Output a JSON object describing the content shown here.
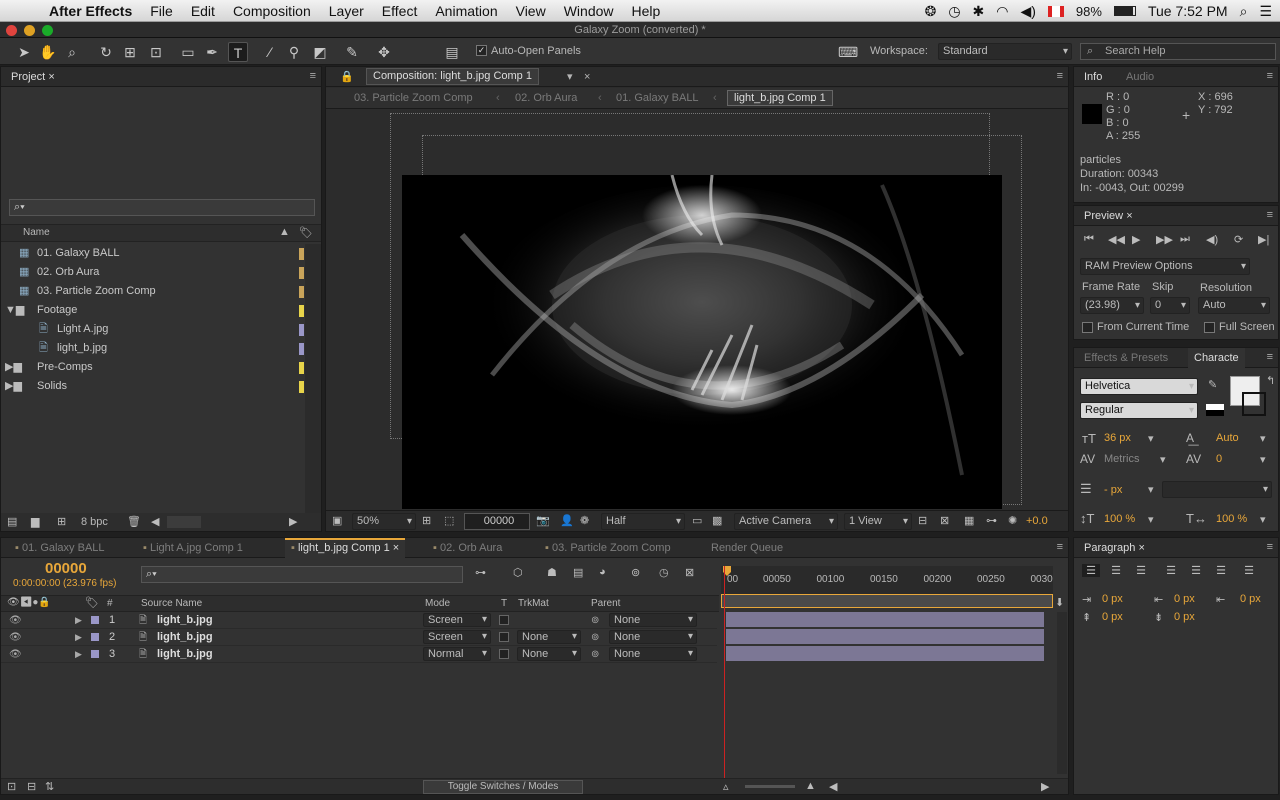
{
  "menubar": {
    "app_name": "After Effects",
    "items": [
      "File",
      "Edit",
      "Composition",
      "Layer",
      "Effect",
      "Animation",
      "View",
      "Window",
      "Help"
    ],
    "battery": "98%",
    "clock": "Tue 7:52 PM"
  },
  "window": {
    "title": "Galaxy Zoom (converted) *"
  },
  "toolbar": {
    "auto_open_panels": "Auto-Open Panels",
    "workspace_label": "Workspace:",
    "workspace_value": "Standard",
    "search_placeholder": "Search Help"
  },
  "project": {
    "tab": "Project",
    "column_name": "Name",
    "items": [
      {
        "label": "01. Galaxy BALL",
        "type": "comp",
        "color": "#c9a45a"
      },
      {
        "label": "02. Orb Aura",
        "type": "comp",
        "color": "#c9a45a"
      },
      {
        "label": "03. Particle Zoom Comp",
        "type": "comp",
        "color": "#c9a45a"
      },
      {
        "label": "Footage",
        "type": "folder-open",
        "color": "#e8d44a"
      },
      {
        "label": "Light A.jpg",
        "type": "file",
        "color": "#9a97c8"
      },
      {
        "label": "light_b.jpg",
        "type": "file",
        "color": "#9a97c8"
      },
      {
        "label": "Pre-Comps",
        "type": "folder",
        "color": "#e8d44a"
      },
      {
        "label": "Solids",
        "type": "folder",
        "color": "#e8d44a"
      }
    ],
    "bpc": "8 bpc"
  },
  "composition": {
    "tab": "Composition: light_b.jpg Comp 1",
    "breadcrumbs": [
      "03. Particle Zoom Comp",
      "02. Orb Aura",
      "01. Galaxy BALL",
      "light_b.jpg Comp 1"
    ],
    "zoom": "50%",
    "timecode": "00000",
    "resolution": "Half",
    "camera": "Active Camera",
    "view": "1 View",
    "exposure": "+0.0"
  },
  "info": {
    "tab": "Info",
    "tab2": "Audio",
    "r": "R : 0",
    "g": "G : 0",
    "b": "B : 0",
    "a": "A : 255",
    "x": "X : 696",
    "y": "Y : 792",
    "layer_name": "particles",
    "duration": "Duration: 00343",
    "in_out": "In: -0043, Out: 00299"
  },
  "preview": {
    "tab": "Preview",
    "ram_options": "RAM Preview Options",
    "frame_rate_label": "Frame Rate",
    "skip_label": "Skip",
    "resolution_label": "Resolution",
    "frame_rate": "(23.98)",
    "skip": "0",
    "resolution": "Auto",
    "from_current": "From Current Time",
    "full_screen": "Full Screen"
  },
  "character": {
    "tab_effects": "Effects & Presets",
    "tab": "Characte",
    "font": "Helvetica",
    "style": "Regular",
    "size": "36 px",
    "leading": "Auto",
    "kerning": "Metrics",
    "tracking": "0",
    "stroke": "- px",
    "vscale": "100 %",
    "hscale": "100 %"
  },
  "paragraph": {
    "tab": "Paragraph",
    "indent_left": "0 px",
    "indent_first": "0 px",
    "indent_right": "0 px",
    "space_before": "0 px",
    "space_after": "0 px"
  },
  "timeline": {
    "tabs": [
      "01. Galaxy BALL",
      "Light A.jpg Comp 1",
      "light_b.jpg Comp 1",
      "02. Orb Aura",
      "03. Particle Zoom Comp",
      "Render Queue"
    ],
    "active_tab": 2,
    "timecode": "00000",
    "timecode_sub": "0:00:00:00 (23.976 fps)",
    "columns": {
      "num": "#",
      "source": "Source Name",
      "mode": "Mode",
      "t": "T",
      "trkmat": "TrkMat",
      "parent": "Parent"
    },
    "ruler": [
      "00050",
      "00100",
      "00150",
      "00200",
      "00250",
      "0030"
    ],
    "ruler_start": "00",
    "layers": [
      {
        "num": "1",
        "name": "light_b.jpg",
        "mode": "Screen",
        "trkmat": "",
        "parent": "None"
      },
      {
        "num": "2",
        "name": "light_b.jpg",
        "mode": "Screen",
        "trkmat": "None",
        "parent": "None"
      },
      {
        "num": "3",
        "name": "light_b.jpg",
        "mode": "Normal",
        "trkmat": "None",
        "parent": "None"
      }
    ],
    "toggle_label": "Toggle Switches / Modes"
  }
}
